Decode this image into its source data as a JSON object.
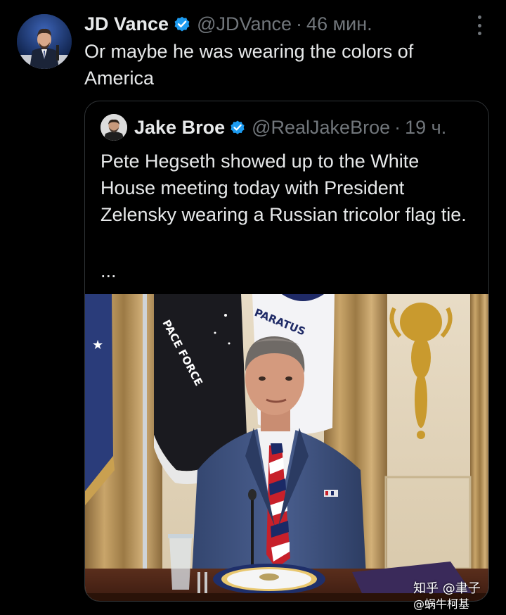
{
  "tweet": {
    "author_name": "JD Vance",
    "handle": "@JDVance",
    "separator": "·",
    "time": "46 мин.",
    "text": "Or maybe he was wearing the colors of America",
    "more_icon": "more-dots-icon",
    "verified_icon": "verified-badge-icon"
  },
  "quoted": {
    "author_name": "Jake Broe",
    "handle": "@RealJakeBroe",
    "separator": "·",
    "time": "19 ч.",
    "text": "Pete Hegseth showed up to the White House meeting today with President Zelensky wearing a Russian tricolor flag tie.",
    "truncation": "...",
    "media": {
      "flag_text_1": "PACE FORCE",
      "flag_text_2": "PARATUS"
    }
  },
  "watermark": {
    "line1": "知乎 @聿子",
    "line2": "@蜗牛柯基"
  },
  "colors": {
    "background": "#000000",
    "text_primary": "#e7e9ea",
    "text_muted": "#71767b",
    "verified_blue": "#1d9bf0",
    "border": "#2f3336"
  }
}
